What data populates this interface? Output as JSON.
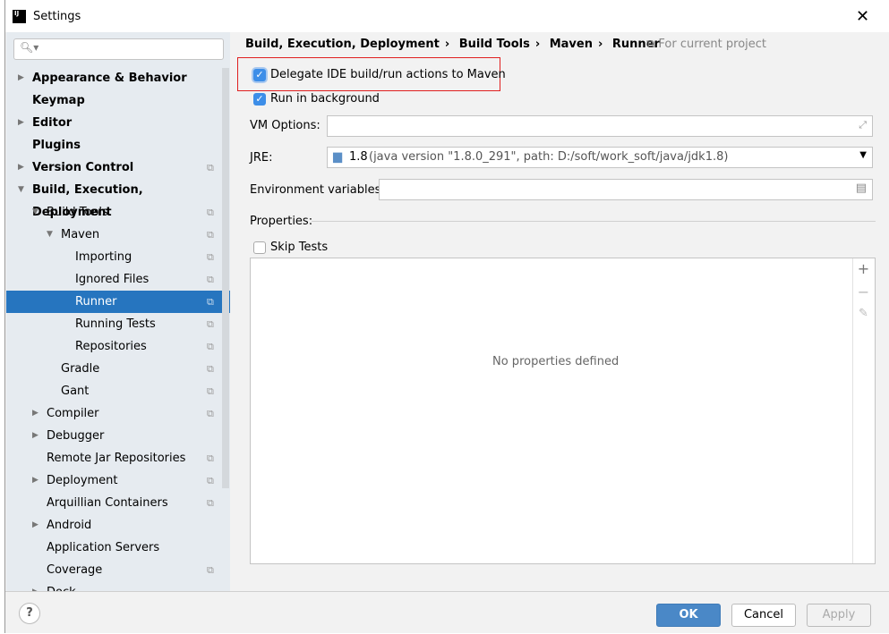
{
  "window": {
    "title": "Settings",
    "close_icon": "close-icon"
  },
  "search": {
    "placeholder": ""
  },
  "tree": [
    {
      "label": "Appearance & Behavior",
      "level": 0,
      "bold": true,
      "arrow": "right"
    },
    {
      "label": "Keymap",
      "level": 0,
      "bold": true
    },
    {
      "label": "Editor",
      "level": 0,
      "bold": true,
      "arrow": "right"
    },
    {
      "label": "Plugins",
      "level": 0,
      "bold": true
    },
    {
      "label": "Version Control",
      "level": 0,
      "bold": true,
      "arrow": "right",
      "copy": true
    },
    {
      "label": "Build, Execution, Deployment",
      "level": 0,
      "bold": true,
      "arrow": "down"
    },
    {
      "label": "Build Tools",
      "level": 1,
      "arrow": "down",
      "copy": true
    },
    {
      "label": "Maven",
      "level": 2,
      "arrow": "down",
      "copy": true
    },
    {
      "label": "Importing",
      "level": 3,
      "copy": true
    },
    {
      "label": "Ignored Files",
      "level": 3,
      "copy": true
    },
    {
      "label": "Runner",
      "level": 3,
      "copy": true,
      "selected": true
    },
    {
      "label": "Running Tests",
      "level": 3,
      "copy": true
    },
    {
      "label": "Repositories",
      "level": 3,
      "copy": true
    },
    {
      "label": "Gradle",
      "level": 2,
      "copy": true
    },
    {
      "label": "Gant",
      "level": 2,
      "copy": true
    },
    {
      "label": "Compiler",
      "level": 1,
      "arrow": "right",
      "copy": true
    },
    {
      "label": "Debugger",
      "level": 1,
      "arrow": "right"
    },
    {
      "label": "Remote Jar Repositories",
      "level": 1,
      "copy": true
    },
    {
      "label": "Deployment",
      "level": 1,
      "arrow": "right",
      "copy": true
    },
    {
      "label": "Arquillian Containers",
      "level": 1,
      "copy": true
    },
    {
      "label": "Android",
      "level": 1,
      "arrow": "right"
    },
    {
      "label": "Application Servers",
      "level": 1
    },
    {
      "label": "Coverage",
      "level": 1,
      "copy": true
    },
    {
      "label": "Dock...",
      "level": 1,
      "arrow": "right"
    }
  ],
  "breadcrumb": [
    "Build, Execution, Deployment",
    "Build Tools",
    "Maven",
    "Runner"
  ],
  "breadcrumb_sep": "›",
  "for_current_project": "For current project",
  "delegate": {
    "label": "Delegate IDE build/run actions to Maven",
    "checked": true
  },
  "background": {
    "label": "Run in background",
    "checked": true
  },
  "vm_options": {
    "label": "VM Options:",
    "value": ""
  },
  "jre": {
    "label": "JRE:",
    "value": "1.8",
    "detail": "(java version \"1.8.0_291\", path: D:/soft/work_soft/java/jdk1.8)"
  },
  "env": {
    "label": "Environment variables:",
    "value": ""
  },
  "properties": {
    "label": "Properties:",
    "empty": "No properties defined"
  },
  "skip_tests": {
    "label": "Skip Tests",
    "checked": false
  },
  "buttons": {
    "ok": "OK",
    "cancel": "Cancel",
    "apply": "Apply",
    "help": "?"
  },
  "colors": {
    "accent": "#2675bf",
    "highlight_border": "#e01f1f"
  }
}
